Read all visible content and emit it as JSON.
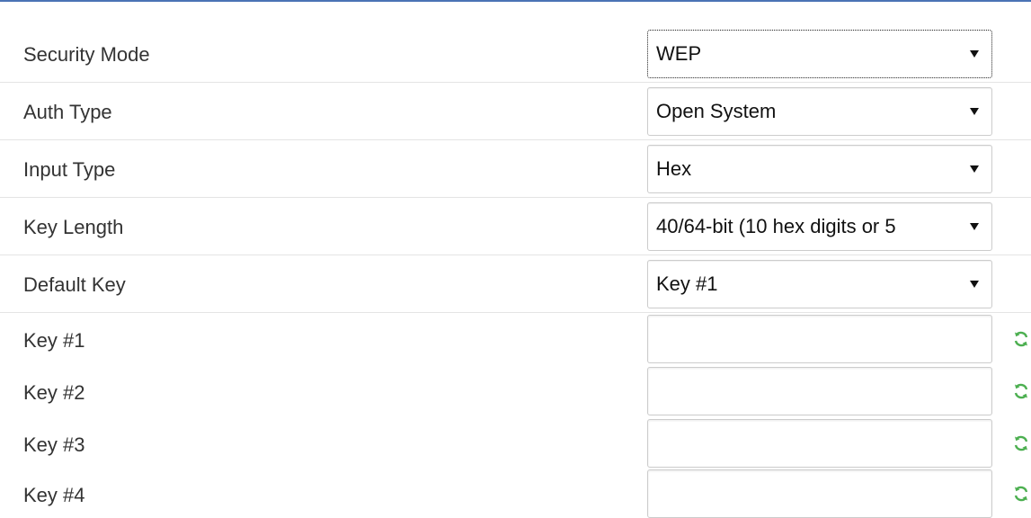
{
  "form": {
    "security_mode": {
      "label": "Security Mode",
      "value": "WEP"
    },
    "auth_type": {
      "label": "Auth Type",
      "value": "Open System"
    },
    "input_type": {
      "label": "Input Type",
      "value": "Hex"
    },
    "key_length": {
      "label": "Key Length",
      "value": "40/64-bit (10 hex digits or 5"
    },
    "default_key": {
      "label": "Default Key",
      "value": "Key #1"
    },
    "keys": [
      {
        "label": "Key #1",
        "value": ""
      },
      {
        "label": "Key #2",
        "value": ""
      },
      {
        "label": "Key #3",
        "value": ""
      },
      {
        "label": "Key #4",
        "value": ""
      }
    ]
  },
  "icons": {
    "key_action": "refresh-icon"
  },
  "colors": {
    "top_rule": "#4a73b5",
    "refresh_icon": "#4caf50"
  }
}
